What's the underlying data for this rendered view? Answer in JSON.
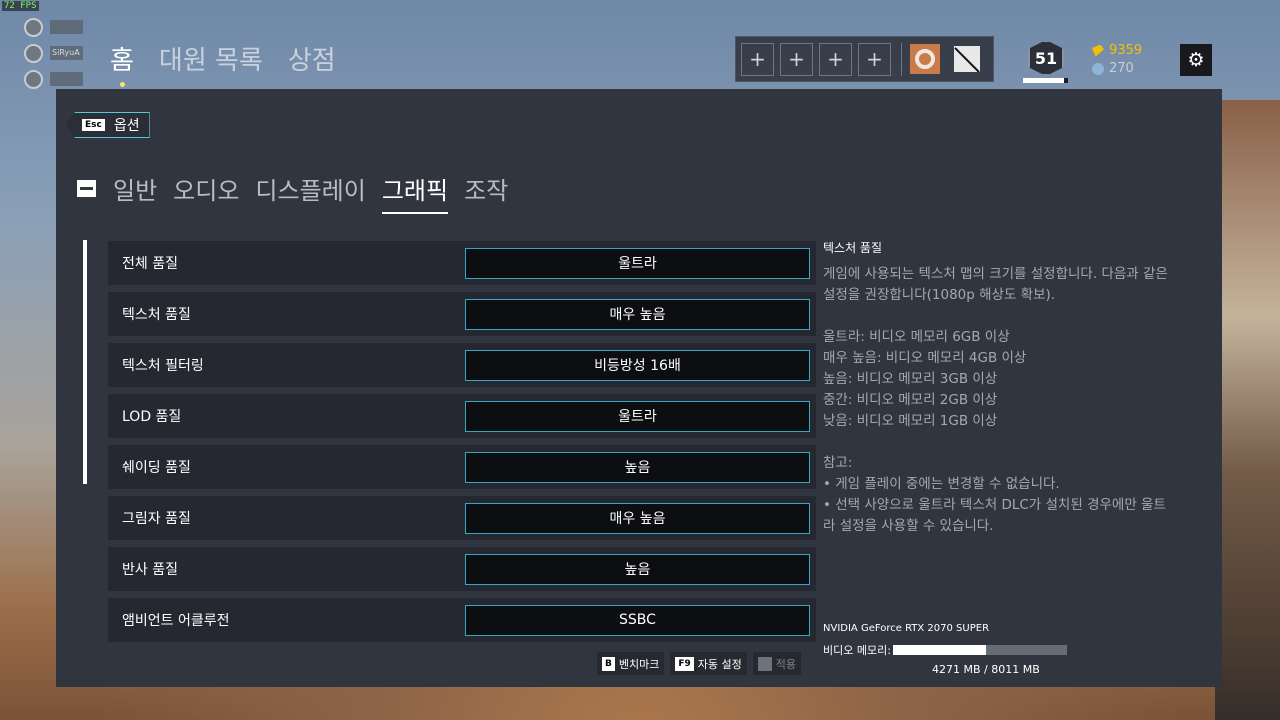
{
  "fps": "72 FPS",
  "players": [
    {
      "name": ""
    },
    {
      "name": "SiRyuA"
    },
    {
      "name": ""
    }
  ],
  "main_nav": [
    "홈",
    "대원 목록",
    "상점"
  ],
  "squad": {
    "slots": [
      "+",
      "+",
      "+",
      "+"
    ]
  },
  "level": {
    "value": "51",
    "progress": 0.92
  },
  "currency": {
    "renown": "9359",
    "credits": "270"
  },
  "options": {
    "back_key": "Esc",
    "back_label": "옵션",
    "tabs": [
      "일반",
      "오디오",
      "디스플레이",
      "그래픽",
      "조작"
    ],
    "active_tab": "그래픽",
    "settings": [
      {
        "label": "전체 품질",
        "value": "울트라"
      },
      {
        "label": "텍스처 품질",
        "value": "매우 높음"
      },
      {
        "label": "텍스처 필터링",
        "value": "비등방성 16배"
      },
      {
        "label": "LOD 품질",
        "value": "울트라"
      },
      {
        "label": "쉐이딩 품질",
        "value": "높음"
      },
      {
        "label": "그림자 품질",
        "value": "매우 높음"
      },
      {
        "label": "반사 품질",
        "value": "높음"
      },
      {
        "label": "앰비언트 어클루전",
        "value": "SSBC"
      }
    ],
    "description": {
      "title": "텍스처 품질",
      "intro": "게임에 사용되는 텍스처 맵의 크기를 설정합니다. 다음과 같은 설정을 권장합니다(1080p 해상도 확보).",
      "levels": [
        "울트라: 비디오 메모리 6GB 이상",
        "매우 높음: 비디오 메모리 4GB 이상",
        "높음: 비디오 메모리 3GB 이상",
        "중간: 비디오 메모리 2GB 이상",
        "낮음: 비디오 메모리 1GB 이상"
      ],
      "note_title": "참고:",
      "notes": [
        "• 게임 플레이 중에는 변경할 수 없습니다.",
        "• 선택 사양으로 울트라 텍스처 DLC가 설치된 경우에만 울트라 설정을 사용할 수 있습니다."
      ]
    },
    "gpu": {
      "name": "NVIDIA GeForce RTX 2070 SUPER",
      "vram_label": "비디오 메모리:",
      "vram_used_fraction": 0.533,
      "vram_text": "4271 MB / 8011 MB"
    },
    "footer": {
      "benchmark_key": "B",
      "benchmark_label": "벤치마크",
      "auto_key": "F9",
      "auto_label": "자동 설정",
      "apply_label": "적용"
    }
  }
}
